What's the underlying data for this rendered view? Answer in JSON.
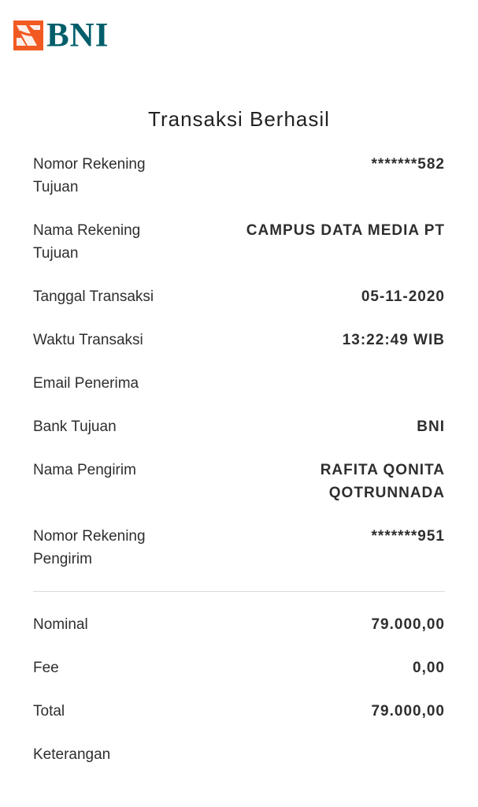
{
  "brand": {
    "logo_text": "BNI",
    "logo_icon": "bni-wave-icon",
    "colors": {
      "logo_text": "#005e6a",
      "logo_mark": "#f15a22"
    }
  },
  "title": "Transaksi Berhasil",
  "details": [
    {
      "label": "Nomor Rekening Tujuan",
      "value": "*******582"
    },
    {
      "label": "Nama Rekening Tujuan",
      "value": "CAMPUS DATA MEDIA PT"
    },
    {
      "label": "Tanggal Transaksi",
      "value": "05-11-2020"
    },
    {
      "label": "Waktu Transaksi",
      "value": "13:22:49 WIB"
    },
    {
      "label": "Email Penerima",
      "value": ""
    },
    {
      "label": "Bank Tujuan",
      "value": "BNI"
    },
    {
      "label": "Nama Pengirim",
      "value": "RAFITA QONITA QOTRUNNADA"
    },
    {
      "label": "Nomor Rekening Pengirim",
      "value": "*******951"
    }
  ],
  "summary": [
    {
      "label": "Nominal",
      "value": "79.000,00"
    },
    {
      "label": "Fee",
      "value": "0,00"
    },
    {
      "label": "Total",
      "value": "79.000,00"
    },
    {
      "label": "Keterangan",
      "value": ""
    }
  ]
}
